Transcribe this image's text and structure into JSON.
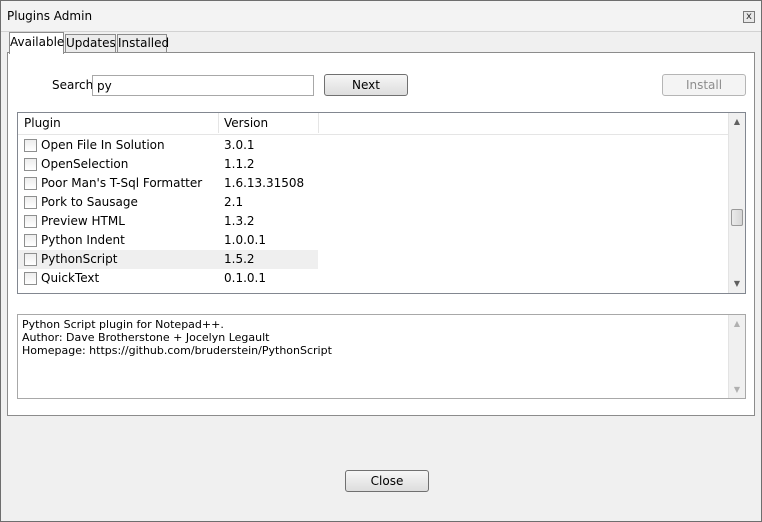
{
  "window": {
    "title": "Plugins Admin",
    "close_glyph": "x"
  },
  "tabs": [
    {
      "label": "Available",
      "active": true
    },
    {
      "label": "Updates",
      "active": false
    },
    {
      "label": "Installed",
      "active": false
    }
  ],
  "search": {
    "label": "Search:",
    "value": "py"
  },
  "buttons": {
    "next": "Next",
    "install": "Install",
    "close": "Close"
  },
  "list": {
    "columns": [
      "Plugin",
      "Version"
    ],
    "rows": [
      {
        "name": "Open File In Solution",
        "version": "3.0.1",
        "checked": false
      },
      {
        "name": "OpenSelection",
        "version": "1.1.2",
        "checked": false
      },
      {
        "name": "Poor Man's T-Sql Formatter",
        "version": "1.6.13.31508",
        "checked": false
      },
      {
        "name": "Pork to Sausage",
        "version": "2.1",
        "checked": false
      },
      {
        "name": "Preview HTML",
        "version": "1.3.2",
        "checked": false
      },
      {
        "name": "Python Indent",
        "version": "1.0.0.1",
        "checked": false
      },
      {
        "name": "PythonScript",
        "version": "1.5.2",
        "checked": false,
        "selected": true
      },
      {
        "name": "QuickText",
        "version": "0.1.0.1",
        "checked": false
      }
    ]
  },
  "description": {
    "lines": [
      "Python Script plugin for Notepad++.",
      "Author: Dave Brotherstone + Jocelyn Legault",
      "Homepage: https://github.com/bruderstein/PythonScript"
    ]
  },
  "icons": {
    "scroll_up": "up-arrow-icon",
    "scroll_down": "down-arrow-icon",
    "checkbox": "checkbox-icon"
  }
}
